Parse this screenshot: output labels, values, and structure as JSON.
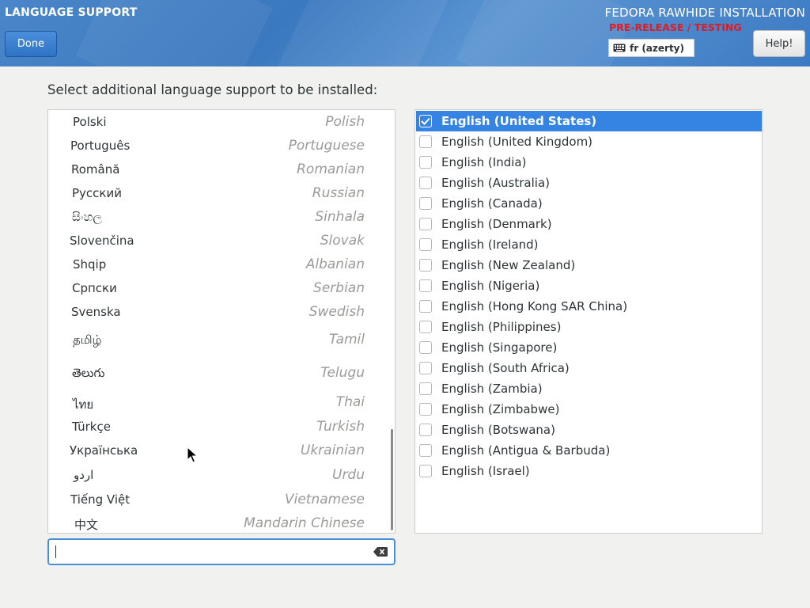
{
  "header": {
    "spoke_title": "LANGUAGE SUPPORT",
    "done_label": "Done",
    "product_title": "FEDORA RAWHIDE INSTALLATION",
    "beta_warning": "PRE-RELEASE / TESTING",
    "keyboard_layout": "fr (azerty)",
    "help_label": "Help!"
  },
  "instruction": "Select additional language support to be installed:",
  "languages": [
    {
      "native": "Polski",
      "english": "Polish"
    },
    {
      "native": "Português",
      "english": "Portuguese"
    },
    {
      "native": "Română",
      "english": "Romanian"
    },
    {
      "native": "Русский",
      "english": "Russian"
    },
    {
      "native": "සිංහල",
      "english": "Sinhala"
    },
    {
      "native": "Slovenčina",
      "english": "Slovak"
    },
    {
      "native": "Shqip",
      "english": "Albanian"
    },
    {
      "native": "Српски",
      "english": "Serbian"
    },
    {
      "native": "Svenska",
      "english": "Swedish"
    },
    {
      "native": "தமிழ்",
      "english": "Tamil"
    },
    {
      "native": "తెలుగు",
      "english": "Telugu"
    },
    {
      "native": "ไทย",
      "english": "Thai"
    },
    {
      "native": "Türkçe",
      "english": "Turkish"
    },
    {
      "native": "Українська",
      "english": "Ukrainian"
    },
    {
      "native": "اردو",
      "english": "Urdu"
    },
    {
      "native": "Tiếng Việt",
      "english": "Vietnamese"
    },
    {
      "native": "中文",
      "english": "Mandarin Chinese"
    }
  ],
  "locales": [
    {
      "label": "English (United States)",
      "checked": true,
      "selected": true
    },
    {
      "label": "English (United Kingdom)",
      "checked": false,
      "selected": false
    },
    {
      "label": "English (India)",
      "checked": false,
      "selected": false
    },
    {
      "label": "English (Australia)",
      "checked": false,
      "selected": false
    },
    {
      "label": "English (Canada)",
      "checked": false,
      "selected": false
    },
    {
      "label": "English (Denmark)",
      "checked": false,
      "selected": false
    },
    {
      "label": "English (Ireland)",
      "checked": false,
      "selected": false
    },
    {
      "label": "English (New Zealand)",
      "checked": false,
      "selected": false
    },
    {
      "label": "English (Nigeria)",
      "checked": false,
      "selected": false
    },
    {
      "label": "English (Hong Kong SAR China)",
      "checked": false,
      "selected": false
    },
    {
      "label": "English (Philippines)",
      "checked": false,
      "selected": false
    },
    {
      "label": "English (Singapore)",
      "checked": false,
      "selected": false
    },
    {
      "label": "English (South Africa)",
      "checked": false,
      "selected": false
    },
    {
      "label": "English (Zambia)",
      "checked": false,
      "selected": false
    },
    {
      "label": "English (Zimbabwe)",
      "checked": false,
      "selected": false
    },
    {
      "label": "English (Botswana)",
      "checked": false,
      "selected": false
    },
    {
      "label": "English (Antigua & Barbuda)",
      "checked": false,
      "selected": false
    },
    {
      "label": "English (Israel)",
      "checked": false,
      "selected": false
    }
  ],
  "search": {
    "value": "",
    "placeholder": ""
  },
  "colors": {
    "accent": "#3584e4",
    "beta_warning": "#e01b24",
    "header": "#4a86c8"
  },
  "icons": {
    "keyboard": "keyboard-icon",
    "clear": "clear-text-icon",
    "check": "checkmark-icon",
    "pointer": "mouse-pointer-icon"
  }
}
